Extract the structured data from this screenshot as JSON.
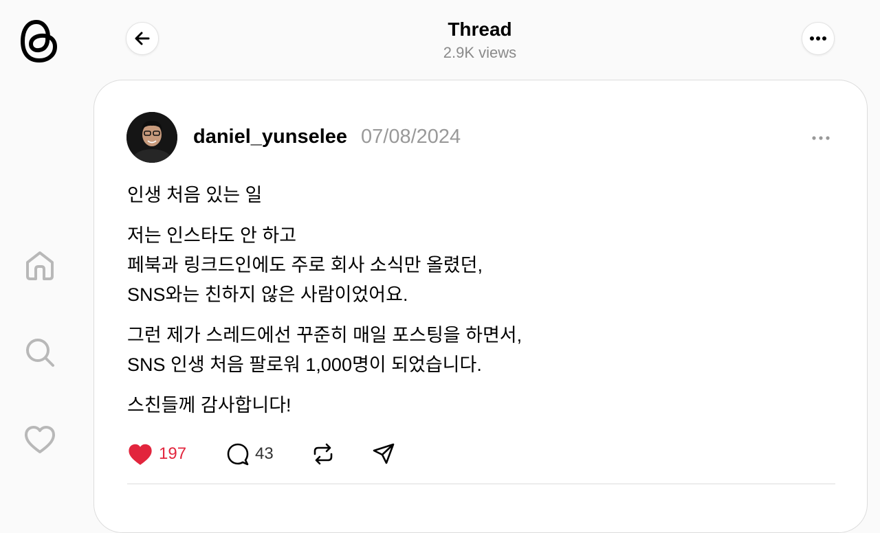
{
  "header": {
    "title": "Thread",
    "views": "2.9K views"
  },
  "post": {
    "username": "daniel_yunselee",
    "date": "07/08/2024",
    "paragraphs": [
      [
        "인생 처음 있는 일"
      ],
      [
        "저는 인스타도 안 하고",
        "페북과 링크드인에도 주로 회사 소식만 올렸던,",
        "SNS와는 친하지 않은 사람이었어요."
      ],
      [
        "그런 제가 스레드에선 꾸준히 매일 포스팅을 하면서,",
        "SNS 인생 처음 팔로워 1,000명이 되었습니다."
      ],
      [
        "스친들께 감사합니다!"
      ]
    ],
    "likes": "197",
    "comments": "43"
  },
  "colors": {
    "like": "#e2253d",
    "muted": "#999999",
    "background": "#fafafa"
  },
  "icons": [
    "threads-logo",
    "home-icon",
    "search-icon",
    "heart-icon",
    "back-arrow-icon",
    "more-icon",
    "heart-filled-icon",
    "comment-icon",
    "repost-icon",
    "share-icon"
  ]
}
